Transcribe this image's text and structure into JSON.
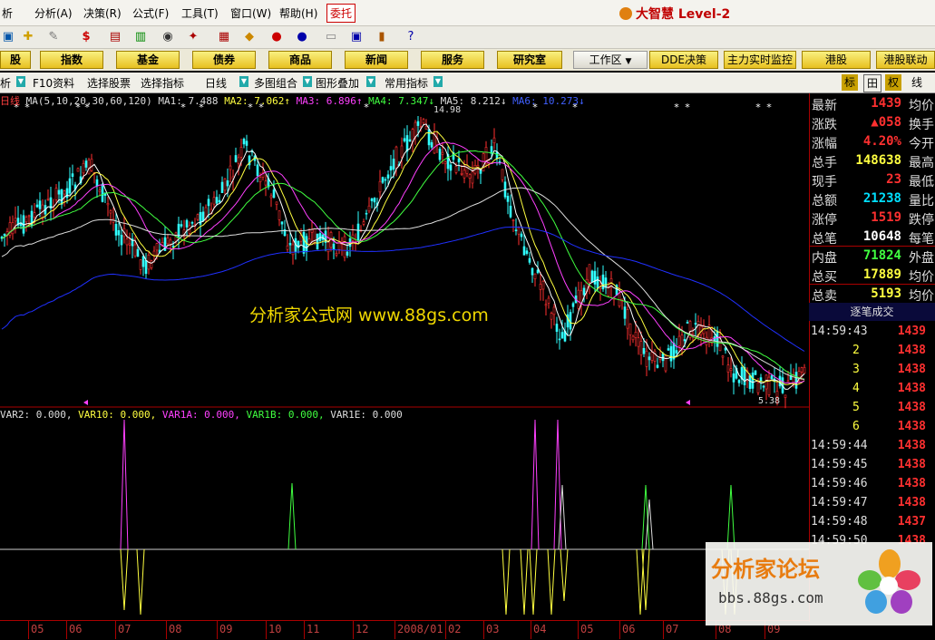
{
  "menu": {
    "items": [
      "分析(A)",
      "决策(R)",
      "公式(F)",
      "工具(T)",
      "窗口(W)",
      "帮助(H)"
    ],
    "partial_first": "析",
    "order_button": "委托",
    "brand": "大智慧 Level-2"
  },
  "navbar": {
    "buttons": [
      "股",
      "指数",
      "基金",
      "债券",
      "商品",
      "新闻",
      "服务",
      "研究室"
    ],
    "workarea": "工作区",
    "right_buttons": [
      "DDE决策",
      "主力实时监控",
      "港股",
      "港股联动"
    ]
  },
  "subbar": {
    "items": [
      "析",
      "F10资料",
      "选择股票",
      "选择指标",
      "日线",
      "多图组合",
      "图形叠加",
      "常用指标"
    ],
    "right_icons": [
      "标",
      "田",
      "权",
      "线"
    ]
  },
  "legend": {
    "prefix": "日线",
    "ma_desc": "MA(5,10,20,30,60,120)",
    "ma1": "MA1: 7.488",
    "ma2": "MA2: 7.062↑",
    "ma3": "MA3: 6.896↑",
    "ma4": "MA4: 7.347↓",
    "ma5": "MA5: 8.212↓",
    "ma6": "MA6: 10.273↓",
    "high_label": "14.98",
    "low_label": "5.38"
  },
  "indicator_legend": {
    "var2": "VAR2: 0.000,",
    "var10": "VAR10: 0.000,",
    "var1a": "VAR1A: 0.000,",
    "var1b": "VAR1B: 0.000,",
    "var1e": "VAR1E: 0.000"
  },
  "watermark": "分析家公式网 www.88gs.com",
  "quote": {
    "rows": [
      {
        "label": "最新",
        "value": "1439",
        "color": "#ff3030",
        "right": "均价"
      },
      {
        "label": "涨跌",
        "value": "▲058",
        "color": "#ff3030",
        "right": "换手"
      },
      {
        "label": "涨幅",
        "value": "4.20%",
        "color": "#ff3030",
        "right": "今开"
      },
      {
        "label": "总手",
        "value": "148638",
        "color": "#ffff40",
        "right": "最高"
      },
      {
        "label": "现手",
        "value": "23",
        "color": "#ff3030",
        "right": "最低"
      },
      {
        "label": "总额",
        "value": "21238",
        "color": "#00e0ff",
        "right": "量比"
      },
      {
        "label": "涨停",
        "value": "1519",
        "color": "#ff3030",
        "right": "跌停"
      },
      {
        "label": "总笔",
        "value": "10648",
        "color": "#ffffff",
        "right": "每笔"
      },
      {
        "label": "内盘",
        "value": "71824",
        "color": "#40ff40",
        "right": "外盘"
      },
      {
        "label": "总买",
        "value": "17889",
        "color": "#ffff40",
        "right": "均价"
      },
      {
        "label": "总卖",
        "value": "5193",
        "color": "#ffff40",
        "right": "均价"
      }
    ],
    "trade_header": "逐笔成交",
    "trades": [
      {
        "time": "14:59:43",
        "price": "1439"
      },
      {
        "time": "2",
        "price": "1438"
      },
      {
        "time": "3",
        "price": "1438"
      },
      {
        "time": "4",
        "price": "1438"
      },
      {
        "time": "5",
        "price": "1438"
      },
      {
        "time": "6",
        "price": "1438"
      },
      {
        "time": "14:59:44",
        "price": "1438"
      },
      {
        "time": "14:59:45",
        "price": "1438"
      },
      {
        "time": "14:59:46",
        "price": "1438"
      },
      {
        "time": "14:59:47",
        "price": "1438"
      },
      {
        "time": "14:59:48",
        "price": "1437"
      },
      {
        "time": "14:59:50",
        "price": "1438"
      }
    ]
  },
  "xaxis": [
    "05",
    "06",
    "07",
    "08",
    "09",
    "10",
    "11",
    "12",
    "2008/01",
    "02",
    "03",
    "04",
    "05",
    "06",
    "07",
    "08",
    "09"
  ],
  "forum": {
    "title": "分析家论坛",
    "url": "bbs.88gs.com"
  }
}
